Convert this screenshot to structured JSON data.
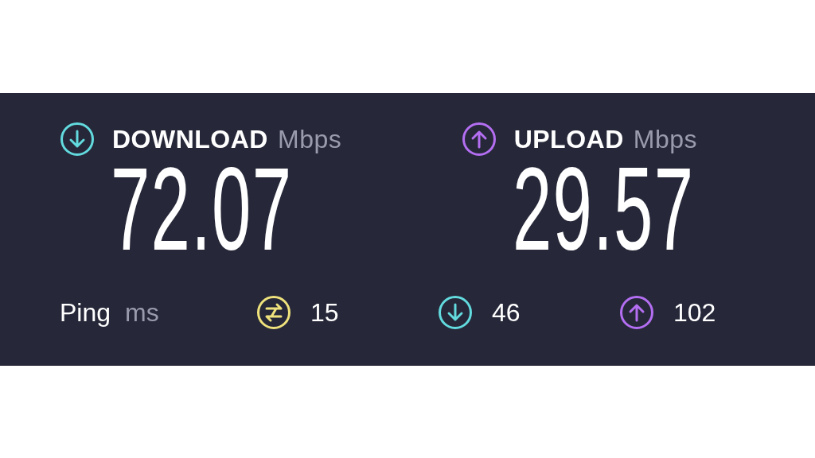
{
  "metrics": [
    {
      "kind": "download",
      "label": "DOWNLOAD",
      "unit": "Mbps",
      "value": "72.07",
      "color": "#62dade"
    },
    {
      "kind": "upload",
      "label": "UPLOAD",
      "unit": "Mbps",
      "value": "29.57",
      "color": "#b46ef2"
    }
  ],
  "ping": {
    "label": "Ping",
    "unit": "ms",
    "stats": [
      {
        "kind": "ping",
        "value": "15",
        "color": "#efe27c"
      },
      {
        "kind": "download",
        "value": "46",
        "color": "#62dade"
      },
      {
        "kind": "upload",
        "value": "102",
        "color": "#b46ef2"
      }
    ]
  }
}
